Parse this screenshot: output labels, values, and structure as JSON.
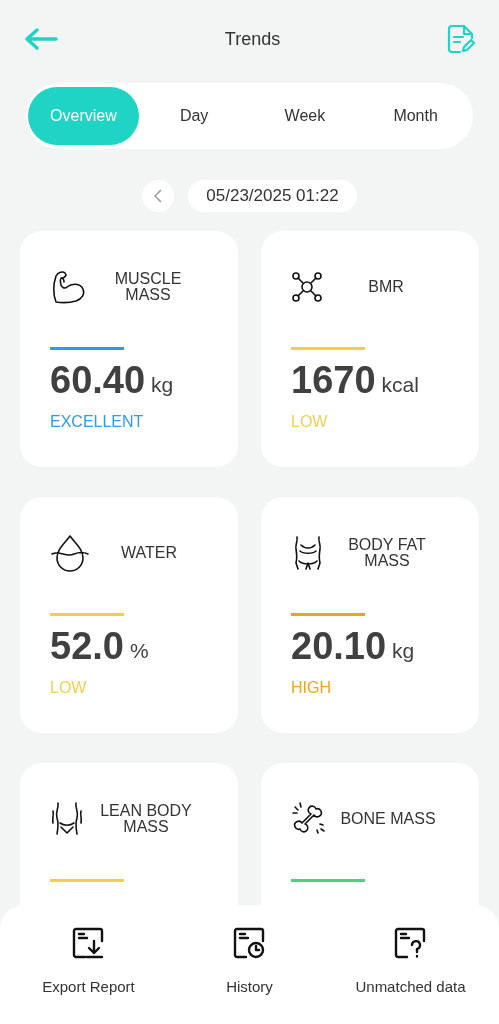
{
  "header": {
    "title": "Trends"
  },
  "tabs": [
    {
      "label": "Overview",
      "selected": true
    },
    {
      "label": "Day",
      "selected": false
    },
    {
      "label": "Week",
      "selected": false
    },
    {
      "label": "Month",
      "selected": false
    }
  ],
  "date": "05/23/2025 01:22",
  "cards": [
    {
      "kind": "muscle",
      "label": "MUSCLE MASS",
      "color": "#2f9be6",
      "value": "60.40",
      "unit": "kg",
      "status": "EXCELLENT"
    },
    {
      "kind": "molecule",
      "label": "BMR",
      "color": "#f0cf4f",
      "value": "1670",
      "unit": "kcal",
      "status": "LOW"
    },
    {
      "kind": "drop",
      "label": "WATER",
      "color": "#f0cf4f",
      "value": "52.0",
      "unit": "%",
      "status": "LOW"
    },
    {
      "kind": "waist",
      "label": "BODY FAT MASS",
      "color": "#eda521",
      "value": "20.10",
      "unit": "kg",
      "status": "HIGH"
    },
    {
      "kind": "lean",
      "label": "LEAN BODY MASS",
      "color": "#f0cf4f"
    },
    {
      "kind": "bone",
      "label": "BONE MASS",
      "color": "#4fcf7f"
    }
  ],
  "actions": [
    {
      "kind": "export",
      "label": "Export Report"
    },
    {
      "kind": "history",
      "label": "History"
    },
    {
      "kind": "unmatched",
      "label": "Unmatched data"
    }
  ]
}
